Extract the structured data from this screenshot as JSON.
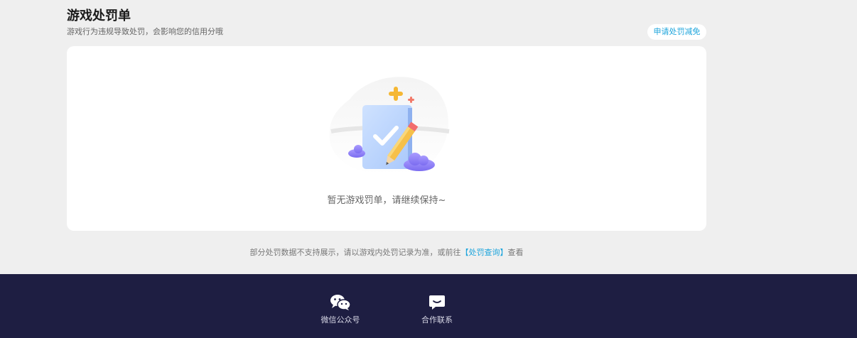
{
  "page": {
    "title": "游戏处罚单",
    "subtitle": "游戏行为违规导致处罚，会影响您的信用分哦",
    "appeal_button": "申请处罚减免"
  },
  "empty_state": {
    "message": "暂无游戏罚单，请继续保持~"
  },
  "notice": {
    "prefix": "部分处罚数据不支持展示，请以游戏内处罚记录为准，或前往",
    "link": "【处罚查询】",
    "suffix": "查看"
  },
  "footer": {
    "items": [
      {
        "label": "微信公众号",
        "icon": "wechat-icon"
      },
      {
        "label": "合作联系",
        "icon": "chat-bubble-icon"
      }
    ]
  },
  "colors": {
    "accent": "#1ea5dc",
    "footer_bg": "#1e1e42",
    "page_bg": "#efefef"
  }
}
